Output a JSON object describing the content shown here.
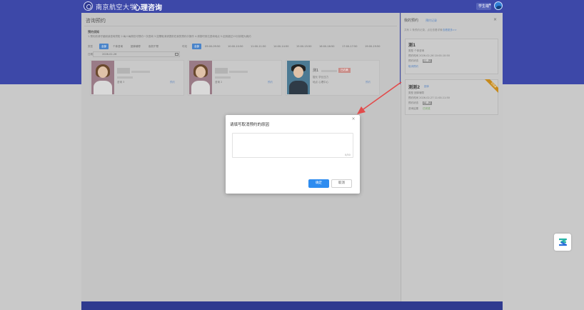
{
  "header": {
    "university_name": "南京航空大学",
    "app_title": "心理咨询",
    "user_name": "学生端"
  },
  "main": {
    "page_title": "咨询预约",
    "notice_title": "预约须知",
    "notice_text": "1.预约前请仔细阅读咨询须知 2.每人每周仅可预约一次咨询 3.如需取消请提前在我的预约中操作 4.请按时到达咨询地点 5.迟到超过15分钟视为爽约",
    "filters": {
      "type_label": "类型",
      "type_tags": [
        "全部",
        "个体咨询",
        "团体辅导",
        "危机干预"
      ],
      "time_label": "时段",
      "time_tags": [
        "全部",
        "09:00-09:50",
        "10:00-10:50",
        "11:00-11:50",
        "14:00-14:50",
        "15:00-15:50",
        "16:00-16:50",
        "17:00-17:50",
        "19:00-19:50"
      ],
      "date_label": "日期",
      "date_value": "2026-02-26"
    },
    "counselors": [
      {
        "name": "",
        "line1": "咨询 3",
        "link": "预约"
      },
      {
        "name": "",
        "line1": "咨询 2",
        "link": "预约"
      },
      {
        "name": "测1",
        "badge": "已约满",
        "line1": "擅长 学业压力",
        "line2": "地点 心理中心",
        "link": "预约"
      }
    ]
  },
  "sidebar": {
    "title": "我的预约",
    "tab": "预约记录",
    "hint": "共有 2 条预约记录，点击查看详情",
    "hint_link": "查看更多>>",
    "appointments": [
      {
        "name": "测1",
        "tag": "",
        "line_type": "类型 个体咨询",
        "line_time": "预约时间 2026-02-26 10:00-10:50",
        "status_label": "预约状态",
        "status": "待确认",
        "action": "取消预约"
      },
      {
        "name": "测测2",
        "tag": "团体",
        "line_type": "类型 团体辅导",
        "line_time": "预约时间 2026-02-27 11:00-11:50",
        "status_label": "预约状态",
        "status": "已确认",
        "result_label": "咨询结果",
        "result": "已完成",
        "ribbon": "已完成"
      }
    ]
  },
  "dialog": {
    "title": "请填写取消预约的原因",
    "reason_value": "",
    "reason_placeholder": "",
    "char_count": "0/50",
    "ok_label": "确定",
    "cancel_label": "取消"
  },
  "colors": {
    "brand": "#3d48a8",
    "primary_button": "#2d8cf0",
    "annotation_arrow": "#e24b4b"
  }
}
